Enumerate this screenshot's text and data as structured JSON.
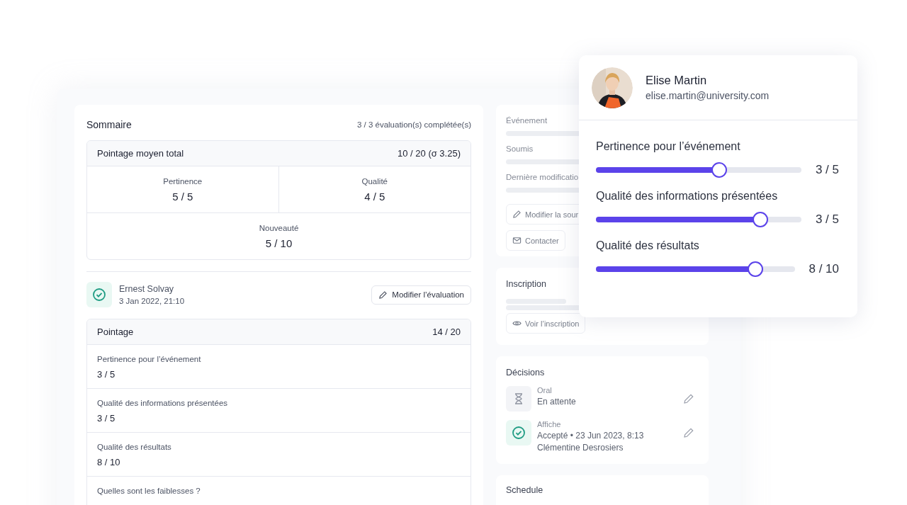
{
  "summary": {
    "title": "Sommaire",
    "count": "3 / 3 évaluation(s) complétée(s)",
    "total": {
      "label": "Pointage moyen total",
      "value": "10 / 20 (σ 3.25)"
    },
    "criteria": [
      {
        "label": "Pertinence",
        "value": "5 / 5"
      },
      {
        "label": "Qualité",
        "value": "4 / 5"
      },
      {
        "label": "Nouveauté",
        "value": "5 / 10"
      }
    ]
  },
  "evaluation": {
    "evaluator": "Ernest Solvay",
    "date": "3 Jan 2022, 21:10",
    "completed": true,
    "edit_button": "Modifier l’évaluation"
  },
  "scores": {
    "title": "Pointage",
    "total": "14 / 20",
    "items": [
      {
        "label": "Pertinence pour l’événement",
        "value": "3 / 5"
      },
      {
        "label": "Qualité des informations présentées",
        "value": "3 / 5"
      },
      {
        "label": "Qualité des résultats",
        "value": "8 / 10"
      }
    ],
    "question": "Quelles sont les faiblesses ?"
  },
  "details": {
    "fields": [
      {
        "label": "Événement"
      },
      {
        "label": "Soumis"
      },
      {
        "label": "Dernière modificatio"
      }
    ],
    "buttons": [
      {
        "kind": "pencil",
        "label": "Modifier la sour"
      },
      {
        "kind": "mail",
        "label": "Contacter"
      }
    ]
  },
  "inscription": {
    "title": "Inscription",
    "button": {
      "kind": "eye",
      "label": "Voir l’inscription"
    }
  },
  "decisions": {
    "title": "Décisions",
    "items": [
      {
        "kind": "pending",
        "category": "Oral",
        "status": "En attente"
      },
      {
        "kind": "accepted",
        "category": "Affiche",
        "status": "Accepté • 23 Jun 2023, 8:13",
        "reviewer": "Clémentine Desrosiers"
      }
    ]
  },
  "schedule": {
    "title": "Schedule"
  },
  "popup": {
    "name": "Elise Martin",
    "email": "elise.martin@university.com",
    "sliders": [
      {
        "label": "Pertinence pour l’événement",
        "level": 0.6,
        "reading": "3 / 5"
      },
      {
        "label": "Qualité des informations présentées",
        "level": 0.8,
        "reading": "3 / 5"
      },
      {
        "label": "Qualité des résultats",
        "level": 0.8,
        "reading": "8 / 10"
      }
    ]
  }
}
